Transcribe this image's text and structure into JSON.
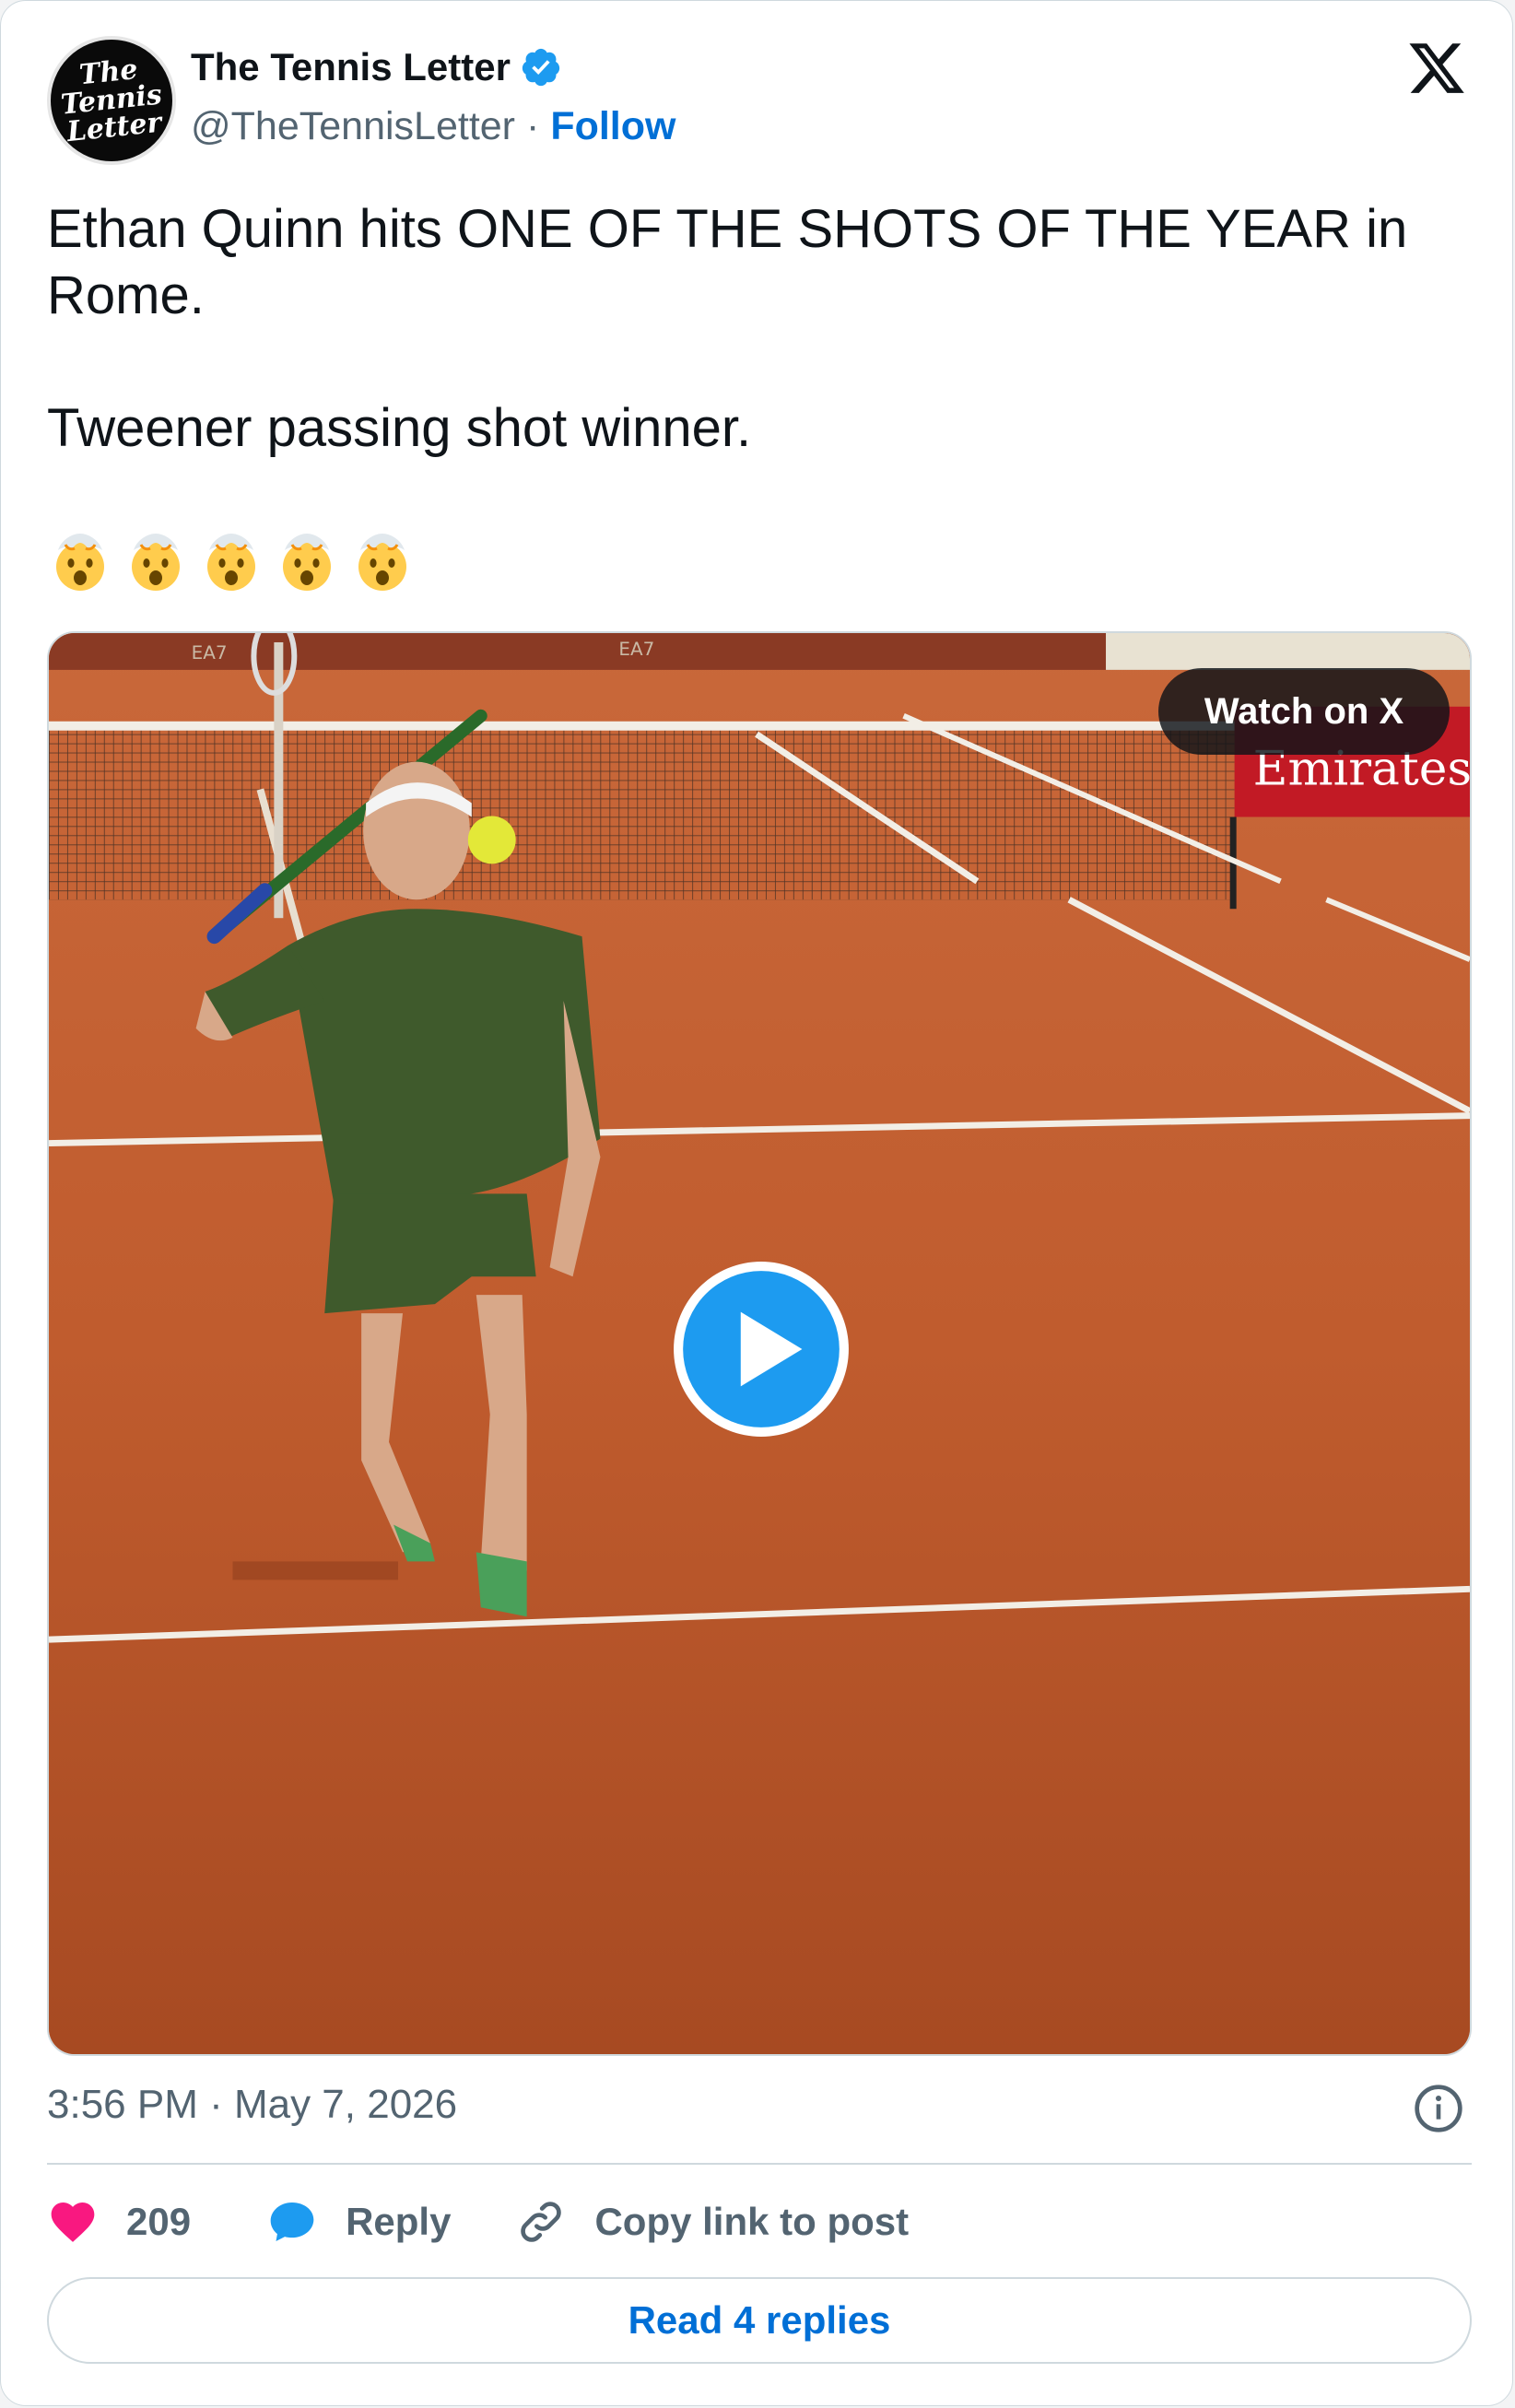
{
  "author": {
    "display_name": "The Tennis Letter",
    "handle": "@TheTennisLetter",
    "follow_label": "Follow",
    "separator": "·",
    "avatar_text": [
      "The",
      "Tennis",
      "Letter"
    ]
  },
  "tweet": {
    "line1": "Ethan Quinn hits ONE OF THE SHOTS OF THE YEAR in Rome.",
    "line2": "Tweener passing shot winner.",
    "emojis": [
      "🤯",
      "🤯",
      "🤯",
      "🤯",
      "🤯"
    ]
  },
  "media": {
    "watch_label": "Watch on X",
    "banner_text": "Emirates",
    "board_text": "EA7"
  },
  "meta": {
    "timestamp": "3:56 PM · May 7, 2026"
  },
  "actions": {
    "like_count": "209",
    "reply_label": "Reply",
    "copy_label": "Copy link to post"
  },
  "footer": {
    "read_replies_label": "Read 4 replies"
  },
  "colors": {
    "link_blue": "#006fd6",
    "verified_blue": "#1d9bf0",
    "like_pink": "#f91880",
    "clay": "#c2602f"
  },
  "icons": [
    "x-logo-icon",
    "verified-badge-icon",
    "play-icon",
    "info-icon",
    "heart-icon",
    "reply-bubble-icon",
    "link-icon"
  ]
}
